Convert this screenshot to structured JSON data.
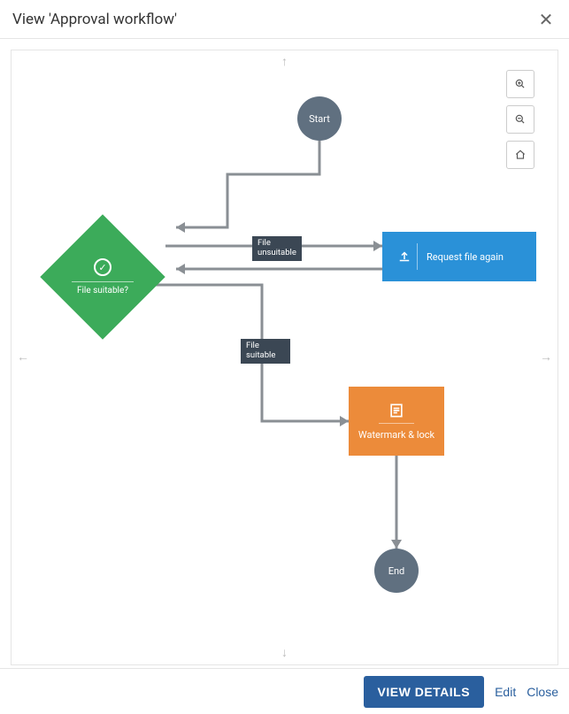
{
  "header": {
    "title": "View 'Approval workflow'"
  },
  "zoom_controls": {
    "zoom_in": "zoom-in",
    "zoom_out": "zoom-out",
    "home": "home"
  },
  "pan": {
    "up": "↑",
    "down": "↓",
    "left": "←",
    "right": "→"
  },
  "nodes": {
    "start": {
      "label": "Start"
    },
    "decision": {
      "label": "File suitable?"
    },
    "request": {
      "label": "Request file again"
    },
    "watermark": {
      "label": "Watermark & lock"
    },
    "end": {
      "label": "End"
    }
  },
  "edge_labels": {
    "unsuitable": "File unsuitable",
    "suitable": "File suitable"
  },
  "footer": {
    "view_details": "VIEW DETAILS",
    "edit": "Edit",
    "close": "Close"
  },
  "colors": {
    "start_end": "#607080",
    "decision": "#3cab5a",
    "request": "#2a91d8",
    "watermark": "#ec8b3a",
    "edge": "#8a8f94",
    "primary": "#2a5f9e"
  }
}
